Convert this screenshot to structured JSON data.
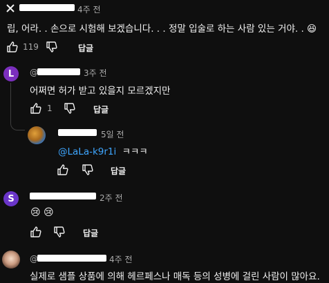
{
  "comments": [
    {
      "time": "4주 전",
      "text": "립, 어라. . 손으로 시험해 보겠습니다. . . 정말 입술로 하는 사람 있는 거야. . 😆",
      "likes": "119",
      "reply_label": "답글"
    },
    {
      "avatar_letter": "L",
      "avatar_color": "#7b2fbe",
      "handle_prefix": "@",
      "time": "3주 전",
      "text": "어쩌면 허가 받고 있을지 모르겠지만",
      "likes": "1",
      "reply_label": "답글"
    },
    {
      "time": "5일 전",
      "mention": "@LaLa-k9r1i",
      "text": "ㅋㅋㅋ",
      "reply_label": "답글"
    },
    {
      "avatar_letter": "S",
      "avatar_color": "#6a35c9",
      "time": "2주 전",
      "text": "😢 😢",
      "reply_label": "답글"
    },
    {
      "handle_prefix": "@",
      "time": "4주 전",
      "text": "실제로 샘플 상품에 의해 헤르페스나 매독 등의 성병에 걸린 사람이 많아요."
    }
  ]
}
